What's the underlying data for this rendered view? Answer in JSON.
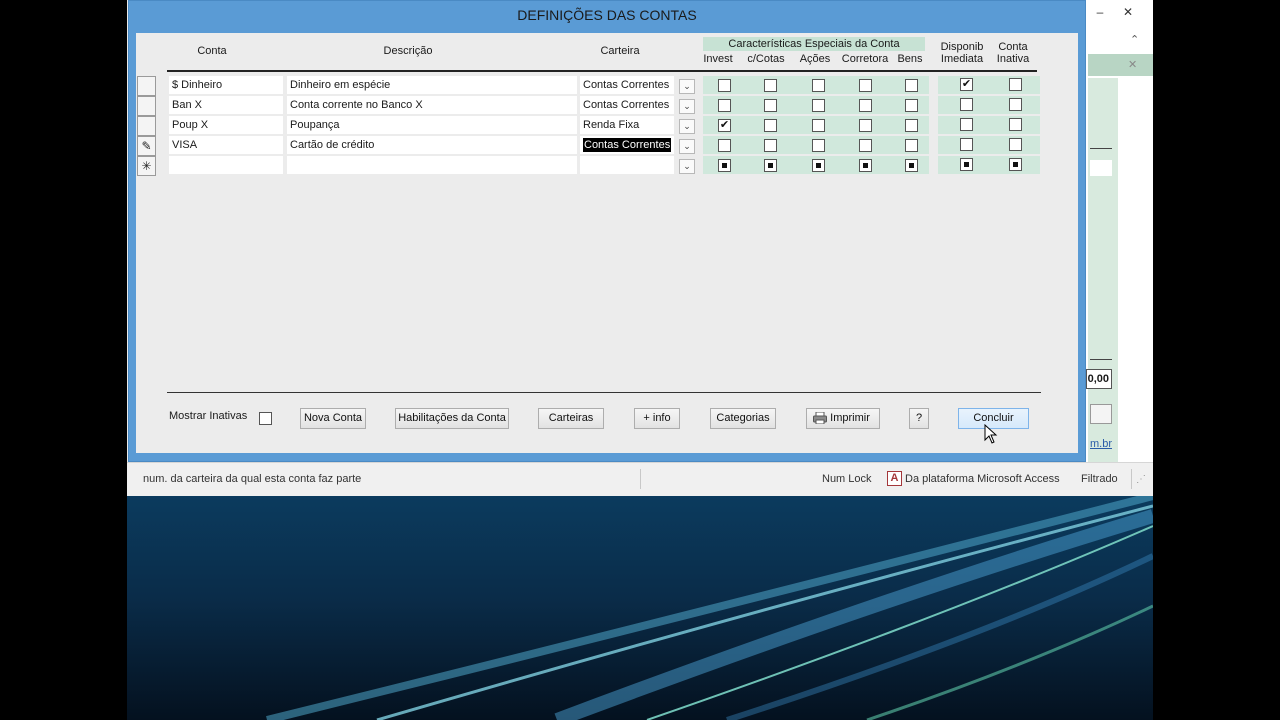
{
  "dialog": {
    "title": "DEFINIÇÕES DAS CONTAS"
  },
  "headers": {
    "conta": "Conta",
    "descricao": "Descrição",
    "carteira": "Carteira",
    "special_group": "Características  Especiais  da  Conta",
    "invest": "Invest",
    "cotas": "c/Cotas",
    "acoes": "Ações",
    "corretora": "Corretora",
    "bens": "Bens",
    "disponib_line1": "Disponib",
    "disponib_line2": "Imediata",
    "inativa_line1": "Conta",
    "inativa_line2": "Inativa"
  },
  "rows": [
    {
      "selector": "",
      "conta": "$ Dinheiro",
      "descricao": "Dinheiro em espécie",
      "carteira": "Contas Correntes",
      "invest": false,
      "cotas": false,
      "acoes": false,
      "corretora": false,
      "bens": false,
      "disponib": true,
      "inativa": false
    },
    {
      "selector": "",
      "conta": "Ban X",
      "descricao": "Conta corrente no Banco X",
      "carteira": "Contas Correntes",
      "invest": false,
      "cotas": false,
      "acoes": false,
      "corretora": false,
      "bens": false,
      "disponib": false,
      "inativa": false
    },
    {
      "selector": "",
      "conta": "Poup X",
      "descricao": "Poupança",
      "carteira": "Renda Fixa",
      "invest": true,
      "cotas": false,
      "acoes": false,
      "corretora": false,
      "bens": false,
      "disponib": false,
      "inativa": false
    },
    {
      "selector": "✎",
      "conta": "VISA",
      "descricao": "Cartão de crédito",
      "carteira": "Contas Correntes",
      "invest": false,
      "cotas": false,
      "acoes": false,
      "corretora": false,
      "bens": false,
      "disponib": false,
      "inativa": false,
      "carteira_selected": true
    },
    {
      "selector": "✳",
      "conta": "",
      "descricao": "",
      "carteira": "",
      "new_row": true
    }
  ],
  "combo_glyph": "⌄",
  "footer": {
    "mostrar_inativas": "Mostrar Inativas",
    "nova_conta": "Nova Conta",
    "habilitacoes": "Habilitações da Conta",
    "carteiras": "Carteiras",
    "info": "+ info",
    "categorias": "Categorias",
    "imprimir": "Imprimir",
    "help": "?",
    "concluir": "Concluir"
  },
  "statusbar": {
    "message": "num. da carteira da qual esta conta faz parte",
    "numlock": "Num Lock",
    "access_icon": "A",
    "platform": "Da plataforma Microsoft Access",
    "filtered": "Filtrado"
  },
  "background_window": {
    "minimize": "–",
    "close": "✕",
    "collapse_ribbon": "⌃",
    "close_small": "✕",
    "value": "0,00",
    "link": "m.br"
  },
  "colors": {
    "dialog_frame": "#5a9bd5",
    "special_bg": "#c7e2d4",
    "grid_green": "#d0e8dc"
  }
}
